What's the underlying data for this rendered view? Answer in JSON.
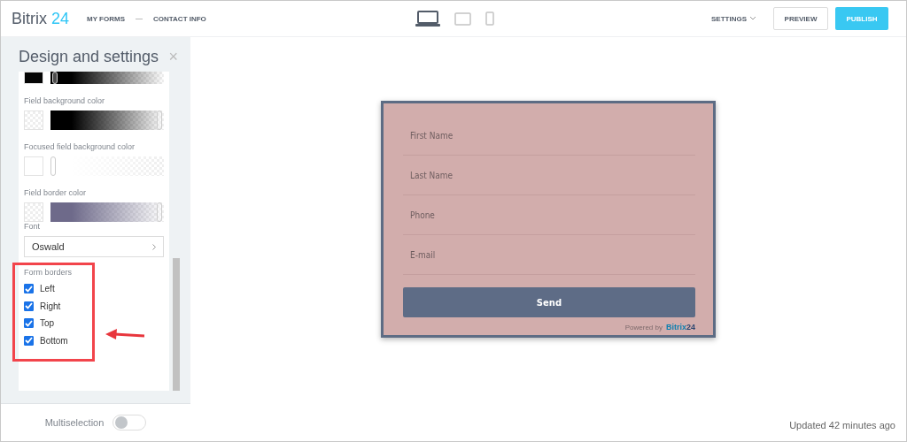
{
  "header": {
    "logo": {
      "name": "Bitrix",
      "number": "24"
    },
    "breadcrumbs": [
      "MY FORMS",
      "CONTACT INFO"
    ],
    "devices": [
      {
        "kind": "desktop",
        "selected": true
      },
      {
        "kind": "tablet",
        "selected": false
      },
      {
        "kind": "phone",
        "selected": false
      }
    ],
    "settings_menu": "SETTINGS",
    "preview_button": "PREVIEW",
    "publish_button": "PUBLISH"
  },
  "panel": {
    "title": "Design and settings",
    "close": "×",
    "color_settings": [
      {
        "color": "#000000",
        "level": 0.02
      },
      {
        "label": "Field background color",
        "color": "#000000",
        "level": 1
      },
      {
        "label": "Focused field background color",
        "color": "#ffffff",
        "level": 0
      },
      {
        "label": "Field border color",
        "color": "#6e6a8a",
        "level": 1
      }
    ],
    "font": {
      "label": "Font",
      "value": "Oswald"
    },
    "form_borders": {
      "label": "Form borders",
      "options": [
        {
          "label": "Left",
          "checked": true
        },
        {
          "label": "Right",
          "checked": true
        },
        {
          "label": "Top",
          "checked": true
        },
        {
          "label": "Bottom",
          "checked": true
        }
      ]
    },
    "multiselection": {
      "label": "Multiselection",
      "on": false
    }
  },
  "form": {
    "fields": [
      {
        "placeholder": "First Name"
      },
      {
        "placeholder": "Last Name"
      },
      {
        "placeholder": "Phone"
      },
      {
        "placeholder": "E-mail"
      }
    ],
    "send_button": "Send",
    "powered_by": {
      "text": "Powered by",
      "name": "Bitrix",
      "number": "24"
    }
  },
  "status": "Updated 42 minutes ago"
}
